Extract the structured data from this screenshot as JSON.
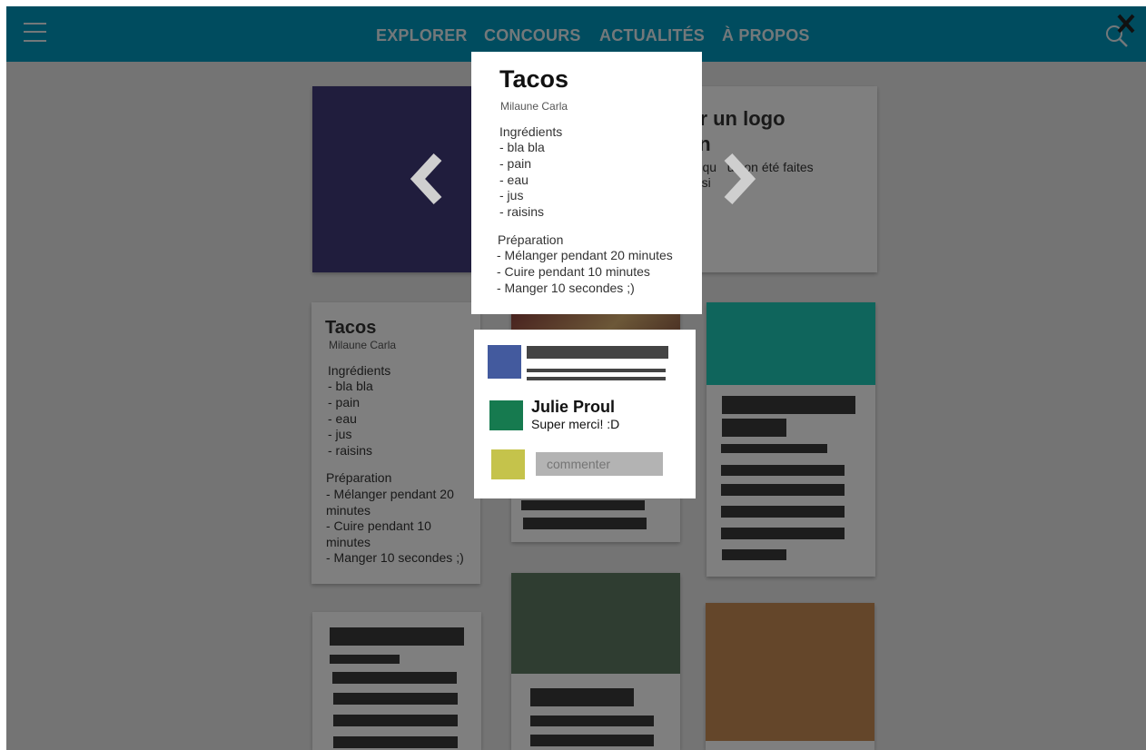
{
  "nav": {
    "links": [
      "EXPLORER",
      "CONCOURS",
      "ACTUALITÉS",
      "À PROPOS"
    ],
    "icons": [
      "hamburger-menu-icon",
      "search-icon",
      "close-icon"
    ]
  },
  "carousel": {
    "title_visible": "ur un logo\nen",
    "text_visible": "on qu   us on été faites\nhoisi"
  },
  "recipe_card": {
    "title": "Tacos",
    "author": "Milaune Carla",
    "ingredients_heading": "Ingrédients",
    "ingredients": [
      "- bla bla",
      "- pain",
      "- eau",
      "- jus",
      "- raisins"
    ],
    "preparation_heading": "Préparation",
    "steps": [
      "- Mélanger pendant 20 minutes",
      "- Cuire pendant 10 minutes",
      "- Manger 10 secondes ;)"
    ]
  },
  "modal": {
    "title": "Tacos",
    "author": "Milaune Carla",
    "ingredients_heading": "Ingrédients",
    "ingredients": [
      "- bla bla",
      "- pain",
      "- eau",
      "- jus",
      "- raisins"
    ],
    "preparation_heading": "Préparation",
    "steps": [
      "- Mélanger pendant 20 minutes",
      "- Cuire pendant 10 minutes",
      "- Manger 10 secondes ;)"
    ]
  },
  "comments": {
    "author": "Julie Proul",
    "text": "Super merci! :D",
    "input_placeholder": "commenter"
  },
  "colors": {
    "nav": "#0099bf",
    "overlay": "rgba(0,0,0,0.5)",
    "carousel_image": "#403a7a",
    "teal": "#1ecab8",
    "dark_green": "#5f7a63",
    "brown": "#c88c55",
    "avatar_blue": "#435a9e",
    "avatar_green": "#167a4f",
    "avatar_yellow": "#c5c34b"
  }
}
